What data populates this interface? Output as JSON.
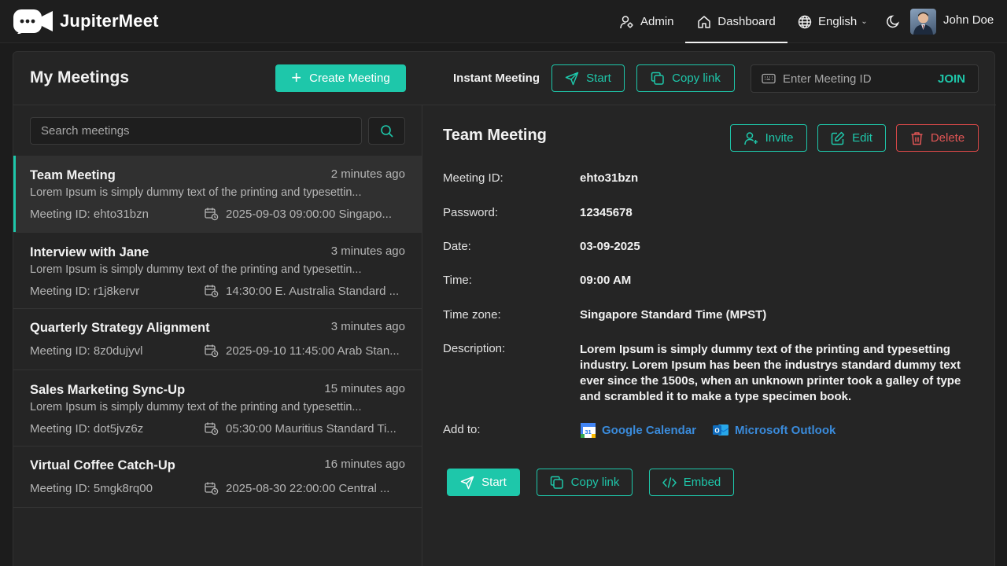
{
  "app": {
    "name": "JupiterMeet"
  },
  "nav": {
    "admin": "Admin",
    "dashboard": "Dashboard",
    "language": "English",
    "user_name": "John Doe"
  },
  "header": {
    "title": "My Meetings",
    "create_label": "Create Meeting",
    "instant_label": "Instant Meeting",
    "start_label": "Start",
    "copy_link_label": "Copy link",
    "meeting_id_placeholder": "Enter Meeting ID",
    "join_label": "JOIN"
  },
  "search": {
    "placeholder": "Search meetings"
  },
  "meetings": [
    {
      "title": "Team Meeting",
      "time_ago": "2 minutes ago",
      "description": "Lorem Ipsum is simply dummy text of the printing and typesettin...",
      "meeting_id": "Meeting ID: ehto31bzn",
      "schedule": "2025-09-03 09:00:00 Singapo..."
    },
    {
      "title": "Interview with Jane",
      "time_ago": "3 minutes ago",
      "description": "Lorem Ipsum is simply dummy text of the printing and typesettin...",
      "meeting_id": "Meeting ID: r1j8kervr",
      "schedule": "14:30:00 E. Australia Standard ..."
    },
    {
      "title": "Quarterly Strategy Alignment",
      "time_ago": "3 minutes ago",
      "description": "",
      "meeting_id": "Meeting ID: 8z0dujyvl",
      "schedule": "2025-09-10 11:45:00 Arab Stan..."
    },
    {
      "title": "Sales Marketing Sync-Up",
      "time_ago": "15 minutes ago",
      "description": "Lorem Ipsum is simply dummy text of the printing and typesettin...",
      "meeting_id": "Meeting ID: dot5jvz6z",
      "schedule": "05:30:00 Mauritius Standard Ti..."
    },
    {
      "title": "Virtual Coffee Catch-Up",
      "time_ago": "16 minutes ago",
      "description": "",
      "meeting_id": "Meeting ID: 5mgk8rq00",
      "schedule": "2025-08-30 22:00:00 Central ..."
    }
  ],
  "details": {
    "title": "Team Meeting",
    "invite_label": "Invite",
    "edit_label": "Edit",
    "delete_label": "Delete",
    "rows": {
      "meeting_id": {
        "label": "Meeting ID:",
        "value": "ehto31bzn"
      },
      "password": {
        "label": "Password:",
        "value": "12345678"
      },
      "date": {
        "label": "Date:",
        "value": "03-09-2025"
      },
      "time": {
        "label": "Time:",
        "value": "09:00 AM"
      },
      "timezone": {
        "label": "Time zone:",
        "value": "Singapore Standard Time (MPST)"
      },
      "description": {
        "label": "Description:",
        "value": "Lorem Ipsum is simply dummy text of the printing and typesetting industry. Lorem Ipsum has been the industrys standard dummy text ever since the 1500s, when an unknown printer took a galley of type and scrambled it to make a type specimen book."
      }
    },
    "add_to_label": "Add to:",
    "google_calendar": "Google Calendar",
    "google_icon_text": "31",
    "microsoft_outlook": "Microsoft Outlook",
    "outlook_icon_text": "O",
    "start_label": "Start",
    "copy_link_label": "Copy link",
    "embed_label": "Embed"
  },
  "colors": {
    "accent": "#1ec7aa",
    "danger": "#e05555",
    "link": "#3a8bdb",
    "background": "#1c1c1c",
    "panel": "#252525"
  }
}
